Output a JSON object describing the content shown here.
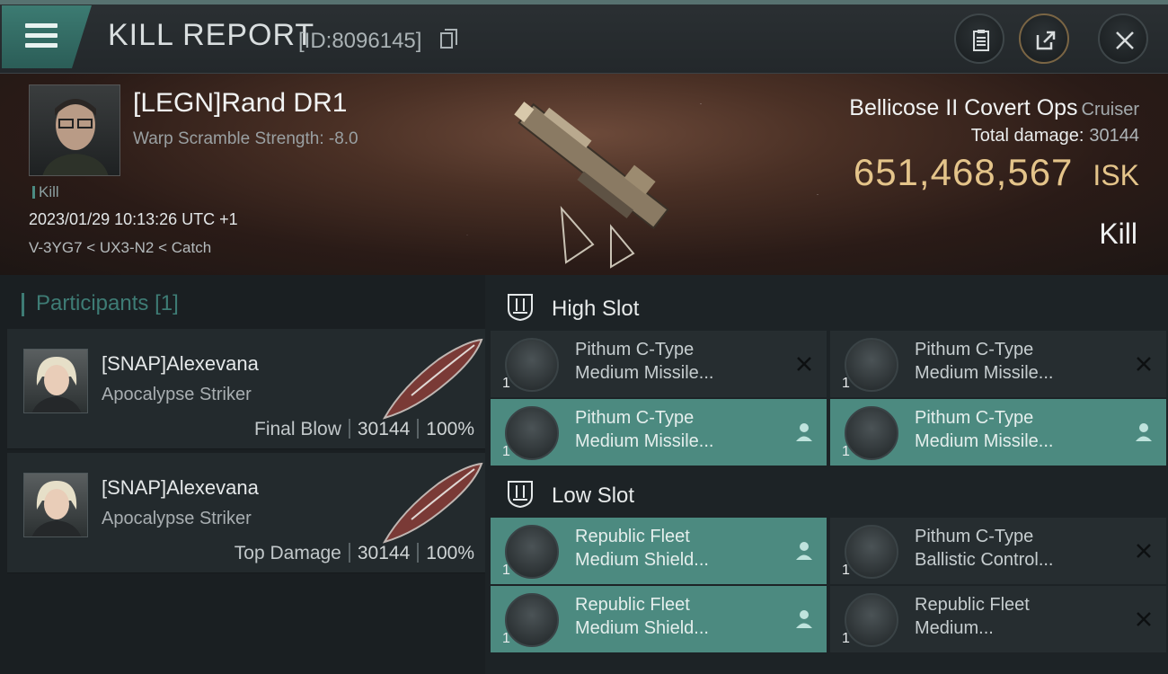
{
  "header": {
    "title": "KILL REPORT",
    "report_id": "[ID:8096145]",
    "buttons": [
      "menu-icon",
      "clipboard-icon",
      "share-icon",
      "close-icon"
    ]
  },
  "victim": {
    "name": "[LEGN]Rand DR1",
    "subtext": "Warp Scramble Strength: -8.0",
    "tag": "Kill",
    "datetime": "2023/01/29 10:13:26 UTC +1",
    "location": "V-3YG7 < UX3-N2 < Catch",
    "ship_name": "Bellicose II Covert Ops",
    "ship_class": "Cruiser",
    "total_damage_label": "Total damage:",
    "total_damage": "30144",
    "isk_value": "651,468,567",
    "isk_unit": "ISK",
    "result": "Kill"
  },
  "participants": {
    "title": "Participants",
    "count": "[1]",
    "items": [
      {
        "name": "[SNAP]Alexevana",
        "ship": "Apocalypse Striker",
        "role": "Final Blow",
        "damage": "30144",
        "percent": "100%"
      },
      {
        "name": "[SNAP]Alexevana",
        "ship": "Apocalypse Striker",
        "role": "Top Damage",
        "damage": "30144",
        "percent": "100%"
      }
    ]
  },
  "slots": {
    "high": {
      "label": "High Slot",
      "modules": [
        {
          "line1": "Pithum C-Type",
          "line2": "Medium Missile...",
          "qty": "1",
          "state": "destroyed"
        },
        {
          "line1": "Pithum C-Type",
          "line2": "Medium Missile...",
          "qty": "1",
          "state": "destroyed"
        },
        {
          "line1": "Pithum C-Type",
          "line2": "Medium Missile...",
          "qty": "1",
          "state": "dropped"
        },
        {
          "line1": "Pithum C-Type",
          "line2": "Medium Missile...",
          "qty": "1",
          "state": "dropped"
        }
      ]
    },
    "low": {
      "label": "Low Slot",
      "modules": [
        {
          "line1": "Republic Fleet",
          "line2": "Medium Shield...",
          "qty": "1",
          "state": "dropped"
        },
        {
          "line1": "Pithum C-Type",
          "line2": "Ballistic Control...",
          "qty": "1",
          "state": "destroyed"
        },
        {
          "line1": "Republic Fleet",
          "line2": "Medium Shield...",
          "qty": "1",
          "state": "dropped"
        },
        {
          "line1": "Republic Fleet",
          "line2": "Medium...",
          "qty": "1",
          "state": "destroyed"
        }
      ]
    }
  },
  "colors": {
    "accent": "#4c8a80",
    "isk": "#e4c48a",
    "background": "#1a1f22"
  }
}
